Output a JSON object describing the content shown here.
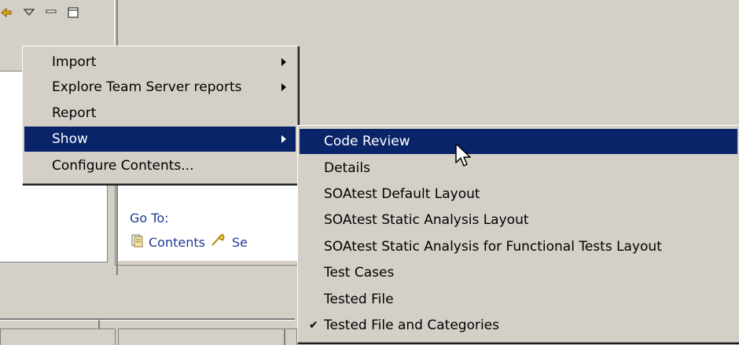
{
  "background": {
    "go_to_label": "Go To:",
    "contents_link": "Contents",
    "search_link_partial": "Se"
  },
  "context_menu": {
    "items": [
      {
        "label": "Import",
        "has_submenu": true
      },
      {
        "label": "Explore Team Server reports",
        "has_submenu": true
      },
      {
        "label": "Report",
        "has_submenu": false
      },
      {
        "label": "Show",
        "has_submenu": true,
        "selected": true
      },
      {
        "label": "Configure Contents...",
        "has_submenu": false
      }
    ]
  },
  "show_submenu": {
    "items": [
      {
        "label": "Code Review",
        "selected": true
      },
      {
        "label": "Details"
      },
      {
        "label": "SOAtest Default Layout"
      },
      {
        "label": "SOAtest Static Analysis Layout"
      },
      {
        "label": "SOAtest Static Analysis for Functional Tests Layout"
      },
      {
        "label": "Test Cases"
      },
      {
        "label": "Tested File"
      },
      {
        "label": "Tested File and Categories",
        "checked": true
      }
    ]
  },
  "colors": {
    "menu_bg": "#d4d0c8",
    "selection": "#0a246a",
    "link": "#1f3a93"
  }
}
